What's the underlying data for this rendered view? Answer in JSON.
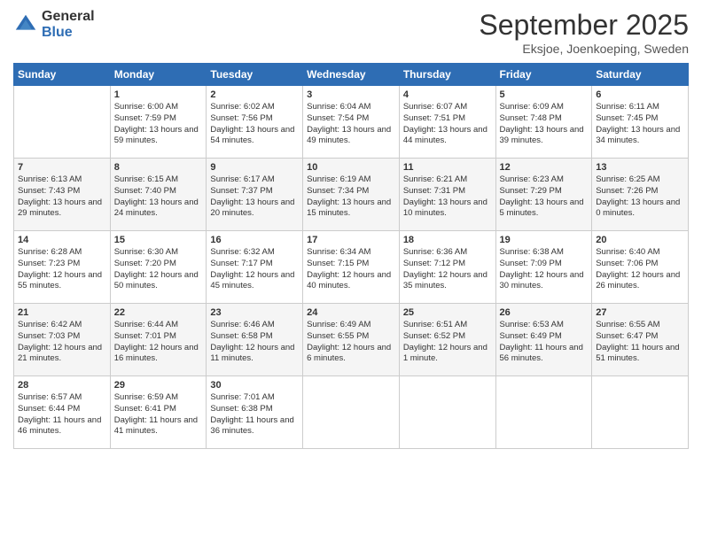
{
  "logo": {
    "general": "General",
    "blue": "Blue"
  },
  "header": {
    "month": "September 2025",
    "location": "Eksjoe, Joenkoeping, Sweden"
  },
  "days_of_week": [
    "Sunday",
    "Monday",
    "Tuesday",
    "Wednesday",
    "Thursday",
    "Friday",
    "Saturday"
  ],
  "weeks": [
    [
      {
        "day": "",
        "sunrise": "",
        "sunset": "",
        "daylight": ""
      },
      {
        "day": "1",
        "sunrise": "Sunrise: 6:00 AM",
        "sunset": "Sunset: 7:59 PM",
        "daylight": "Daylight: 13 hours and 59 minutes."
      },
      {
        "day": "2",
        "sunrise": "Sunrise: 6:02 AM",
        "sunset": "Sunset: 7:56 PM",
        "daylight": "Daylight: 13 hours and 54 minutes."
      },
      {
        "day": "3",
        "sunrise": "Sunrise: 6:04 AM",
        "sunset": "Sunset: 7:54 PM",
        "daylight": "Daylight: 13 hours and 49 minutes."
      },
      {
        "day": "4",
        "sunrise": "Sunrise: 6:07 AM",
        "sunset": "Sunset: 7:51 PM",
        "daylight": "Daylight: 13 hours and 44 minutes."
      },
      {
        "day": "5",
        "sunrise": "Sunrise: 6:09 AM",
        "sunset": "Sunset: 7:48 PM",
        "daylight": "Daylight: 13 hours and 39 minutes."
      },
      {
        "day": "6",
        "sunrise": "Sunrise: 6:11 AM",
        "sunset": "Sunset: 7:45 PM",
        "daylight": "Daylight: 13 hours and 34 minutes."
      }
    ],
    [
      {
        "day": "7",
        "sunrise": "Sunrise: 6:13 AM",
        "sunset": "Sunset: 7:43 PM",
        "daylight": "Daylight: 13 hours and 29 minutes."
      },
      {
        "day": "8",
        "sunrise": "Sunrise: 6:15 AM",
        "sunset": "Sunset: 7:40 PM",
        "daylight": "Daylight: 13 hours and 24 minutes."
      },
      {
        "day": "9",
        "sunrise": "Sunrise: 6:17 AM",
        "sunset": "Sunset: 7:37 PM",
        "daylight": "Daylight: 13 hours and 20 minutes."
      },
      {
        "day": "10",
        "sunrise": "Sunrise: 6:19 AM",
        "sunset": "Sunset: 7:34 PM",
        "daylight": "Daylight: 13 hours and 15 minutes."
      },
      {
        "day": "11",
        "sunrise": "Sunrise: 6:21 AM",
        "sunset": "Sunset: 7:31 PM",
        "daylight": "Daylight: 13 hours and 10 minutes."
      },
      {
        "day": "12",
        "sunrise": "Sunrise: 6:23 AM",
        "sunset": "Sunset: 7:29 PM",
        "daylight": "Daylight: 13 hours and 5 minutes."
      },
      {
        "day": "13",
        "sunrise": "Sunrise: 6:25 AM",
        "sunset": "Sunset: 7:26 PM",
        "daylight": "Daylight: 13 hours and 0 minutes."
      }
    ],
    [
      {
        "day": "14",
        "sunrise": "Sunrise: 6:28 AM",
        "sunset": "Sunset: 7:23 PM",
        "daylight": "Daylight: 12 hours and 55 minutes."
      },
      {
        "day": "15",
        "sunrise": "Sunrise: 6:30 AM",
        "sunset": "Sunset: 7:20 PM",
        "daylight": "Daylight: 12 hours and 50 minutes."
      },
      {
        "day": "16",
        "sunrise": "Sunrise: 6:32 AM",
        "sunset": "Sunset: 7:17 PM",
        "daylight": "Daylight: 12 hours and 45 minutes."
      },
      {
        "day": "17",
        "sunrise": "Sunrise: 6:34 AM",
        "sunset": "Sunset: 7:15 PM",
        "daylight": "Daylight: 12 hours and 40 minutes."
      },
      {
        "day": "18",
        "sunrise": "Sunrise: 6:36 AM",
        "sunset": "Sunset: 7:12 PM",
        "daylight": "Daylight: 12 hours and 35 minutes."
      },
      {
        "day": "19",
        "sunrise": "Sunrise: 6:38 AM",
        "sunset": "Sunset: 7:09 PM",
        "daylight": "Daylight: 12 hours and 30 minutes."
      },
      {
        "day": "20",
        "sunrise": "Sunrise: 6:40 AM",
        "sunset": "Sunset: 7:06 PM",
        "daylight": "Daylight: 12 hours and 26 minutes."
      }
    ],
    [
      {
        "day": "21",
        "sunrise": "Sunrise: 6:42 AM",
        "sunset": "Sunset: 7:03 PM",
        "daylight": "Daylight: 12 hours and 21 minutes."
      },
      {
        "day": "22",
        "sunrise": "Sunrise: 6:44 AM",
        "sunset": "Sunset: 7:01 PM",
        "daylight": "Daylight: 12 hours and 16 minutes."
      },
      {
        "day": "23",
        "sunrise": "Sunrise: 6:46 AM",
        "sunset": "Sunset: 6:58 PM",
        "daylight": "Daylight: 12 hours and 11 minutes."
      },
      {
        "day": "24",
        "sunrise": "Sunrise: 6:49 AM",
        "sunset": "Sunset: 6:55 PM",
        "daylight": "Daylight: 12 hours and 6 minutes."
      },
      {
        "day": "25",
        "sunrise": "Sunrise: 6:51 AM",
        "sunset": "Sunset: 6:52 PM",
        "daylight": "Daylight: 12 hours and 1 minute."
      },
      {
        "day": "26",
        "sunrise": "Sunrise: 6:53 AM",
        "sunset": "Sunset: 6:49 PM",
        "daylight": "Daylight: 11 hours and 56 minutes."
      },
      {
        "day": "27",
        "sunrise": "Sunrise: 6:55 AM",
        "sunset": "Sunset: 6:47 PM",
        "daylight": "Daylight: 11 hours and 51 minutes."
      }
    ],
    [
      {
        "day": "28",
        "sunrise": "Sunrise: 6:57 AM",
        "sunset": "Sunset: 6:44 PM",
        "daylight": "Daylight: 11 hours and 46 minutes."
      },
      {
        "day": "29",
        "sunrise": "Sunrise: 6:59 AM",
        "sunset": "Sunset: 6:41 PM",
        "daylight": "Daylight: 11 hours and 41 minutes."
      },
      {
        "day": "30",
        "sunrise": "Sunrise: 7:01 AM",
        "sunset": "Sunset: 6:38 PM",
        "daylight": "Daylight: 11 hours and 36 minutes."
      },
      {
        "day": "",
        "sunrise": "",
        "sunset": "",
        "daylight": ""
      },
      {
        "day": "",
        "sunrise": "",
        "sunset": "",
        "daylight": ""
      },
      {
        "day": "",
        "sunrise": "",
        "sunset": "",
        "daylight": ""
      },
      {
        "day": "",
        "sunrise": "",
        "sunset": "",
        "daylight": ""
      }
    ]
  ]
}
